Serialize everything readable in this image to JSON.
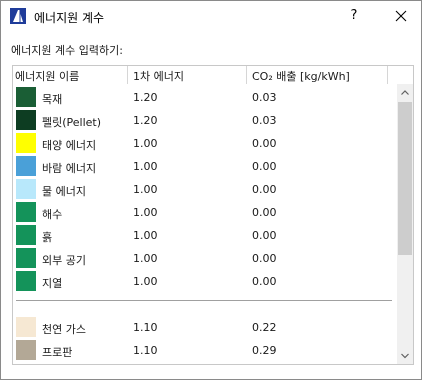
{
  "window": {
    "title": "에너지원 계수",
    "help_label": "?"
  },
  "prompt": "에너지원 계수 입력하기:",
  "columns": {
    "name": "에너지원 이름",
    "primary": "1차 에너지",
    "co2": "CO₂ 배출 [kg/kWh]"
  },
  "rows": [
    {
      "name": "목재",
      "primary": "1.20",
      "co2": "0.03",
      "color": "#1a5e35"
    },
    {
      "name": "펠릿(Pellet)",
      "primary": "1.20",
      "co2": "0.03",
      "color": "#0d3d22"
    },
    {
      "name": "태양 에너지",
      "primary": "1.00",
      "co2": "0.00",
      "color": "#ffff00"
    },
    {
      "name": "바람 에너지",
      "primary": "1.00",
      "co2": "0.00",
      "color": "#4aa0d8"
    },
    {
      "name": "물 에너지",
      "primary": "1.00",
      "co2": "0.00",
      "color": "#b8e8fb"
    },
    {
      "name": "해수",
      "primary": "1.00",
      "co2": "0.00",
      "color": "#14935a"
    },
    {
      "name": "흙",
      "primary": "1.00",
      "co2": "0.00",
      "color": "#14935a"
    },
    {
      "name": "외부 공기",
      "primary": "1.00",
      "co2": "0.00",
      "color": "#14935a"
    },
    {
      "name": "지열",
      "primary": "1.00",
      "co2": "0.00",
      "color": "#14935a"
    },
    {
      "name": "천연 가스",
      "primary": "1.10",
      "co2": "0.22",
      "color": "#f6e8d3"
    },
    {
      "name": "프로판",
      "primary": "1.10",
      "co2": "0.29",
      "color": "#b3a896"
    }
  ]
}
